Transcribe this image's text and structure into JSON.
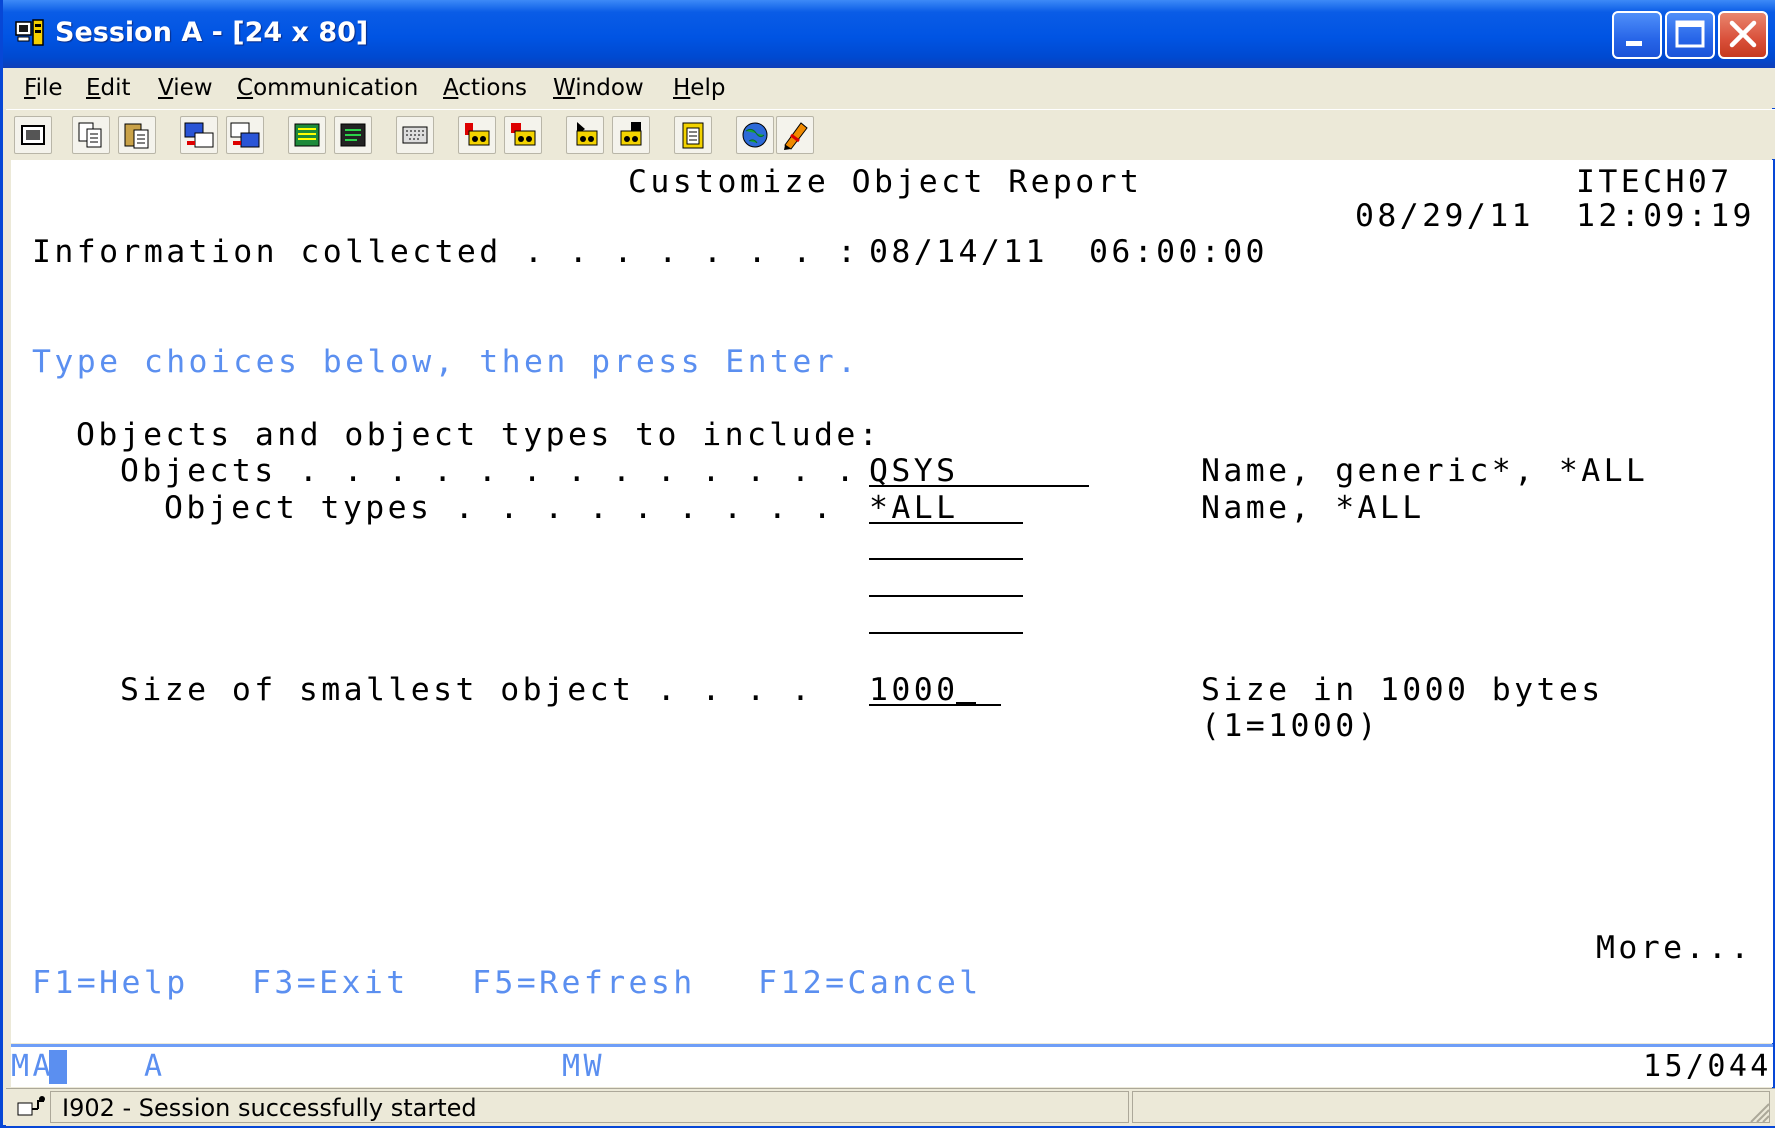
{
  "window": {
    "title": "Session A - [24 x 80]"
  },
  "menu": [
    {
      "label": "File",
      "mnemonic": "F"
    },
    {
      "label": "Edit",
      "mnemonic": "E"
    },
    {
      "label": "View",
      "mnemonic": "V"
    },
    {
      "label": "Communication",
      "mnemonic": "C"
    },
    {
      "label": "Actions",
      "mnemonic": "A"
    },
    {
      "label": "Window",
      "mnemonic": "W"
    },
    {
      "label": "Help",
      "mnemonic": "H"
    }
  ],
  "toolbar": {
    "icons": [
      "print-screen-icon",
      "copy-icon",
      "paste-icon",
      "send-file-icon",
      "receive-file-icon",
      "display-keypad-icon",
      "green-screen-icon",
      "keyboard-map-icon",
      "record-macro-icon",
      "stop-macro-icon",
      "play-macro-icon",
      "macro-icon",
      "clipboard-icon",
      "web-icon",
      "edit-icon"
    ]
  },
  "screen": {
    "title": "Customize Object Report",
    "system": "ITECH07",
    "date": "08/29/11",
    "time": "12:09:19",
    "info_label": "Information collected . . . . . . . :",
    "info_date": "08/14/11",
    "info_time": "06:00:00",
    "instruction": "Type choices below, then press Enter.",
    "section_heading": "Objects and object types to include:",
    "objects_label": "Objects . . . . . . . . . . . . .",
    "objects_value": "QSYS",
    "objects_help": "Name, generic*, *ALL",
    "types_label": "Object types . . . . . . . . .",
    "types_value": "*ALL",
    "types_extra": [
      "",
      "",
      ""
    ],
    "types_help": "Name, *ALL",
    "size_label": "Size of smallest object . . . .",
    "size_value": "1000",
    "size_help": "Size in 1000 bytes",
    "size_help2": "(1=1000)",
    "more": "More...",
    "fkeys": [
      "F1=Help",
      "F3=Exit",
      "F5=Refresh",
      "F12=Cancel"
    ]
  },
  "oia": {
    "indicator": "MA",
    "session": "A",
    "mode": "MW",
    "cursor_position": "15/044"
  },
  "status": {
    "message": "I902 - Session successfully started"
  }
}
